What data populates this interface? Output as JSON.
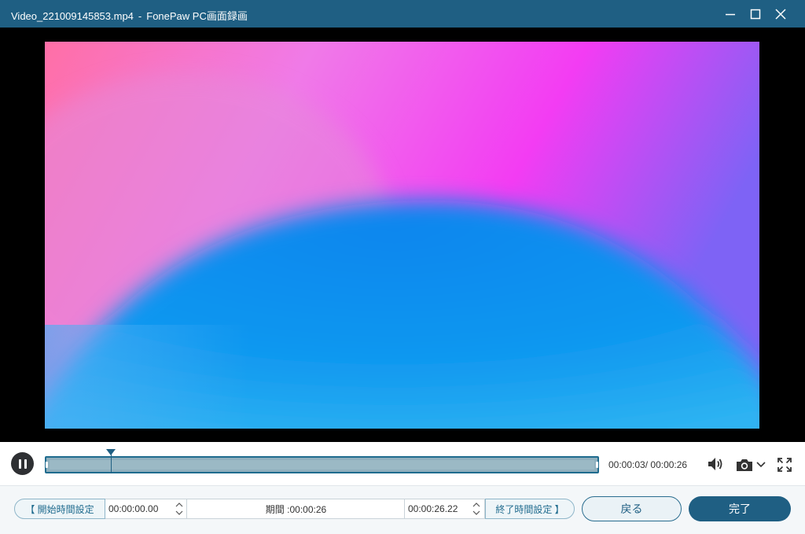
{
  "window": {
    "filename": "Video_221009145853.mp4",
    "separator": "-",
    "app_name": "FonePaw PC画面録画",
    "minimize_icon": "minimize-icon",
    "maximize_icon": "maximize-icon",
    "close_icon": "close-icon"
  },
  "colors": {
    "titlebar": "#1f5f83",
    "accent": "#1f6b8e",
    "timeline_fill": "#8fafbd"
  },
  "player": {
    "pause_icon": "pause-icon",
    "playback_progress": 0.1154,
    "current_time": "00:00:03/",
    "total_time": "00:00:26",
    "volume_icon": "speaker-icon",
    "snapshot_icon": "camera-icon",
    "snapshot_menu_icon": "chevron-down-icon",
    "fullscreen_icon": "fullscreen-icon"
  },
  "trim": {
    "set_start_label": "【 開始時間設定",
    "start_time": "00:00:00.00",
    "duration_label": "期間 :00:00:26",
    "end_time": "00:00:26.22",
    "set_end_label": "終了時間設定 】",
    "spin_up_icon": "chevron-up-icon",
    "spin_down_icon": "chevron-down-icon"
  },
  "actions": {
    "back_label": "戻る",
    "done_label": "完了"
  }
}
